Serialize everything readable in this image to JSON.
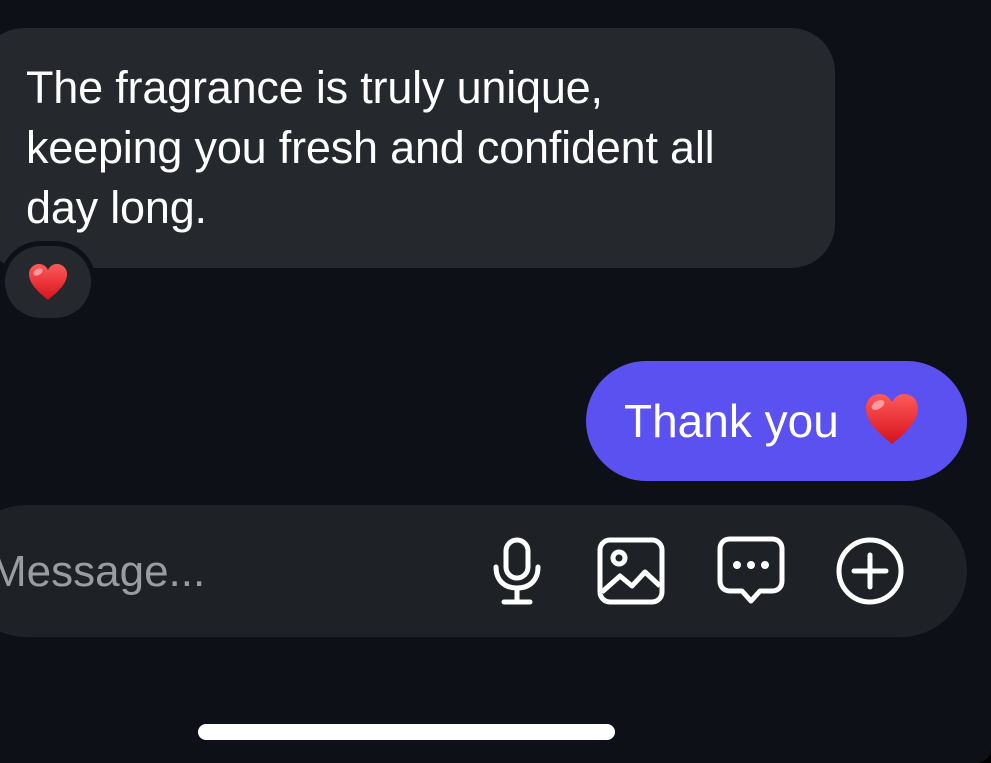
{
  "messages": {
    "incoming": {
      "line1": "The fragrance is truly unique,",
      "line2": "keeping you fresh and confident all",
      "line3": "day long.",
      "reaction_icon": "red-heart-emoji"
    },
    "outgoing": {
      "text": "Thank you",
      "emoji_icon": "red-heart-emoji"
    }
  },
  "composer": {
    "placeholder": "Message...",
    "icons": [
      "microphone-icon",
      "image-icon",
      "chat-bubble-more-icon",
      "add-circle-icon"
    ]
  },
  "colors": {
    "background": "#0d1016",
    "incoming_bubble": "#25282d",
    "outgoing_bubble": "#5b50f0",
    "composer_bg": "#1e2125",
    "placeholder_text": "#9a9ca2",
    "heart": "#e8262c"
  }
}
